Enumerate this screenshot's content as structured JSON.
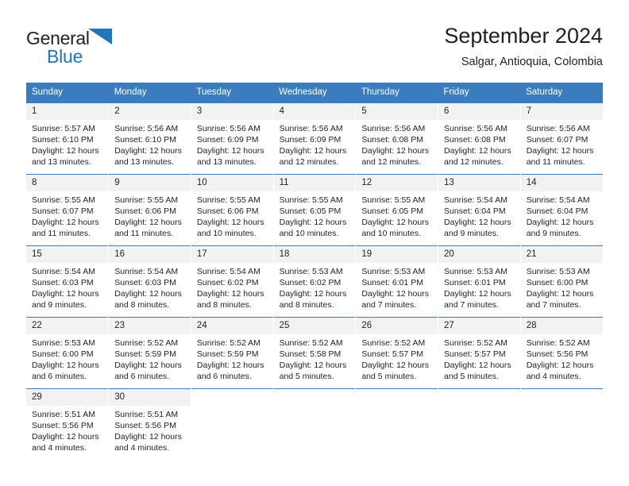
{
  "brand": {
    "name_part1": "General",
    "name_part2": "Blue",
    "accent_color": "#2175ba"
  },
  "header": {
    "title": "September 2024",
    "subtitle": "Salgar, Antioquia, Colombia"
  },
  "theme": {
    "header_bg": "#3b7cbf",
    "daynum_bg": "#f2f2f2",
    "text": "#231f20"
  },
  "weekdays": [
    "Sunday",
    "Monday",
    "Tuesday",
    "Wednesday",
    "Thursday",
    "Friday",
    "Saturday"
  ],
  "weeks": [
    [
      {
        "day": "1",
        "sunrise": "Sunrise: 5:57 AM",
        "sunset": "Sunset: 6:10 PM",
        "daylight1": "Daylight: 12 hours",
        "daylight2": "and 13 minutes."
      },
      {
        "day": "2",
        "sunrise": "Sunrise: 5:56 AM",
        "sunset": "Sunset: 6:10 PM",
        "daylight1": "Daylight: 12 hours",
        "daylight2": "and 13 minutes."
      },
      {
        "day": "3",
        "sunrise": "Sunrise: 5:56 AM",
        "sunset": "Sunset: 6:09 PM",
        "daylight1": "Daylight: 12 hours",
        "daylight2": "and 13 minutes."
      },
      {
        "day": "4",
        "sunrise": "Sunrise: 5:56 AM",
        "sunset": "Sunset: 6:09 PM",
        "daylight1": "Daylight: 12 hours",
        "daylight2": "and 12 minutes."
      },
      {
        "day": "5",
        "sunrise": "Sunrise: 5:56 AM",
        "sunset": "Sunset: 6:08 PM",
        "daylight1": "Daylight: 12 hours",
        "daylight2": "and 12 minutes."
      },
      {
        "day": "6",
        "sunrise": "Sunrise: 5:56 AM",
        "sunset": "Sunset: 6:08 PM",
        "daylight1": "Daylight: 12 hours",
        "daylight2": "and 12 minutes."
      },
      {
        "day": "7",
        "sunrise": "Sunrise: 5:56 AM",
        "sunset": "Sunset: 6:07 PM",
        "daylight1": "Daylight: 12 hours",
        "daylight2": "and 11 minutes."
      }
    ],
    [
      {
        "day": "8",
        "sunrise": "Sunrise: 5:55 AM",
        "sunset": "Sunset: 6:07 PM",
        "daylight1": "Daylight: 12 hours",
        "daylight2": "and 11 minutes."
      },
      {
        "day": "9",
        "sunrise": "Sunrise: 5:55 AM",
        "sunset": "Sunset: 6:06 PM",
        "daylight1": "Daylight: 12 hours",
        "daylight2": "and 11 minutes."
      },
      {
        "day": "10",
        "sunrise": "Sunrise: 5:55 AM",
        "sunset": "Sunset: 6:06 PM",
        "daylight1": "Daylight: 12 hours",
        "daylight2": "and 10 minutes."
      },
      {
        "day": "11",
        "sunrise": "Sunrise: 5:55 AM",
        "sunset": "Sunset: 6:05 PM",
        "daylight1": "Daylight: 12 hours",
        "daylight2": "and 10 minutes."
      },
      {
        "day": "12",
        "sunrise": "Sunrise: 5:55 AM",
        "sunset": "Sunset: 6:05 PM",
        "daylight1": "Daylight: 12 hours",
        "daylight2": "and 10 minutes."
      },
      {
        "day": "13",
        "sunrise": "Sunrise: 5:54 AM",
        "sunset": "Sunset: 6:04 PM",
        "daylight1": "Daylight: 12 hours",
        "daylight2": "and 9 minutes."
      },
      {
        "day": "14",
        "sunrise": "Sunrise: 5:54 AM",
        "sunset": "Sunset: 6:04 PM",
        "daylight1": "Daylight: 12 hours",
        "daylight2": "and 9 minutes."
      }
    ],
    [
      {
        "day": "15",
        "sunrise": "Sunrise: 5:54 AM",
        "sunset": "Sunset: 6:03 PM",
        "daylight1": "Daylight: 12 hours",
        "daylight2": "and 9 minutes."
      },
      {
        "day": "16",
        "sunrise": "Sunrise: 5:54 AM",
        "sunset": "Sunset: 6:03 PM",
        "daylight1": "Daylight: 12 hours",
        "daylight2": "and 8 minutes."
      },
      {
        "day": "17",
        "sunrise": "Sunrise: 5:54 AM",
        "sunset": "Sunset: 6:02 PM",
        "daylight1": "Daylight: 12 hours",
        "daylight2": "and 8 minutes."
      },
      {
        "day": "18",
        "sunrise": "Sunrise: 5:53 AM",
        "sunset": "Sunset: 6:02 PM",
        "daylight1": "Daylight: 12 hours",
        "daylight2": "and 8 minutes."
      },
      {
        "day": "19",
        "sunrise": "Sunrise: 5:53 AM",
        "sunset": "Sunset: 6:01 PM",
        "daylight1": "Daylight: 12 hours",
        "daylight2": "and 7 minutes."
      },
      {
        "day": "20",
        "sunrise": "Sunrise: 5:53 AM",
        "sunset": "Sunset: 6:01 PM",
        "daylight1": "Daylight: 12 hours",
        "daylight2": "and 7 minutes."
      },
      {
        "day": "21",
        "sunrise": "Sunrise: 5:53 AM",
        "sunset": "Sunset: 6:00 PM",
        "daylight1": "Daylight: 12 hours",
        "daylight2": "and 7 minutes."
      }
    ],
    [
      {
        "day": "22",
        "sunrise": "Sunrise: 5:53 AM",
        "sunset": "Sunset: 6:00 PM",
        "daylight1": "Daylight: 12 hours",
        "daylight2": "and 6 minutes."
      },
      {
        "day": "23",
        "sunrise": "Sunrise: 5:52 AM",
        "sunset": "Sunset: 5:59 PM",
        "daylight1": "Daylight: 12 hours",
        "daylight2": "and 6 minutes."
      },
      {
        "day": "24",
        "sunrise": "Sunrise: 5:52 AM",
        "sunset": "Sunset: 5:59 PM",
        "daylight1": "Daylight: 12 hours",
        "daylight2": "and 6 minutes."
      },
      {
        "day": "25",
        "sunrise": "Sunrise: 5:52 AM",
        "sunset": "Sunset: 5:58 PM",
        "daylight1": "Daylight: 12 hours",
        "daylight2": "and 5 minutes."
      },
      {
        "day": "26",
        "sunrise": "Sunrise: 5:52 AM",
        "sunset": "Sunset: 5:57 PM",
        "daylight1": "Daylight: 12 hours",
        "daylight2": "and 5 minutes."
      },
      {
        "day": "27",
        "sunrise": "Sunrise: 5:52 AM",
        "sunset": "Sunset: 5:57 PM",
        "daylight1": "Daylight: 12 hours",
        "daylight2": "and 5 minutes."
      },
      {
        "day": "28",
        "sunrise": "Sunrise: 5:52 AM",
        "sunset": "Sunset: 5:56 PM",
        "daylight1": "Daylight: 12 hours",
        "daylight2": "and 4 minutes."
      }
    ],
    [
      {
        "day": "29",
        "sunrise": "Sunrise: 5:51 AM",
        "sunset": "Sunset: 5:56 PM",
        "daylight1": "Daylight: 12 hours",
        "daylight2": "and 4 minutes."
      },
      {
        "day": "30",
        "sunrise": "Sunrise: 5:51 AM",
        "sunset": "Sunset: 5:56 PM",
        "daylight1": "Daylight: 12 hours",
        "daylight2": "and 4 minutes."
      },
      {
        "day": "",
        "sunrise": "",
        "sunset": "",
        "daylight1": "",
        "daylight2": ""
      },
      {
        "day": "",
        "sunrise": "",
        "sunset": "",
        "daylight1": "",
        "daylight2": ""
      },
      {
        "day": "",
        "sunrise": "",
        "sunset": "",
        "daylight1": "",
        "daylight2": ""
      },
      {
        "day": "",
        "sunrise": "",
        "sunset": "",
        "daylight1": "",
        "daylight2": ""
      },
      {
        "day": "",
        "sunrise": "",
        "sunset": "",
        "daylight1": "",
        "daylight2": ""
      }
    ]
  ]
}
